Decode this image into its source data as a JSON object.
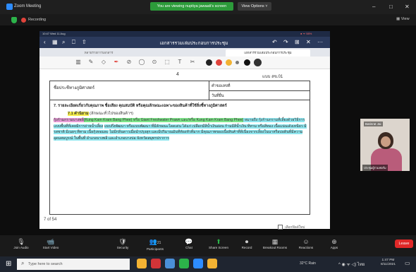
{
  "window": {
    "title": "Zoom Meeting",
    "minimize": "–",
    "maximize": "□",
    "close": "✕"
  },
  "share_banner": "You are viewing nuptiya jawaati's screen",
  "view_options": "View Options ˅",
  "recording": {
    "label": "Recording"
  },
  "view_btn": "▦ View",
  "ipad": {
    "status_time": "10:47 Wed 11 Aug",
    "status_right": "● ᯤ 98%",
    "doc_title": "เอกสารรวมเล่มประกอบการประชุม",
    "tabs": [
      "หลายรายการเอกสาร",
      "เอกสารรวมเล่มประกอบการประชุม"
    ],
    "nav_icons": [
      "‹",
      "▦",
      "⌕",
      "⎕",
      "⇧"
    ],
    "nav_right": [
      "↶",
      "↷",
      "⊞",
      "✕",
      "···"
    ],
    "tools": [
      "▥",
      "✎",
      "◇",
      "✒",
      "⊘",
      "◯",
      "⊙",
      "⬚",
      "T",
      "✂"
    ],
    "colors": [
      "#222222",
      "#e0433b",
      "#f2b233",
      "#777777",
      "#111111",
      "#333333"
    ]
  },
  "doc": {
    "page_number": "4",
    "form": "แบบ สข.01",
    "name_label": "ชื่อประชีทางภูมิศาสตร์",
    "reg_label": "คำขอเลขที่",
    "date_label": "วันที่ยื่น",
    "section7": "7. รายละเอียดเกี่ยวกับคุณภาพ ชื่อเสียง คุณสมบัติ หรือคุณลักษณะเฉพาะของสินค้าที่ใช้สิ่งชี้ทางภูมิศาสตร์",
    "sub71_label": "7.1 คำนิยาม",
    "sub71_rest": " (ลักษณะทั่วไปของสินค้าฯ)",
    "para_pink": "กุ้งก้ามกรามบางพลี",
    "para_en": "(Kung Kam Kram Bang Phee) หรือ Giant Freshwater Prawn และ/หรือ Kung Kam Kram Bang Phee)",
    "para_rest1": " หมายถึง กุ้งก้ามกรามที่เลี้ยงด้วยวิธีการแบบพื้นที่ที่เคยมีการถ่ายน้ำเลี้ยง",
    "para_rest2": "แบบกึ่งพัฒนา หรือแบบพัฒนา ที่มีลักษณะโดดเด่น ได้แก่ เปลือกมีสีน้ำเงินอ่อน ก้ามมีสีน้ำเงิน ทีทาม หรือสีทอง เนื้อแน่นเด้งเหนียว มีรสชาติ มีเนยๆ ทีทาม เนื้อกุ้งหอมละ",
    "para_rest3": "ไม่มีกลิ่นดาวเมื่อนำปรุงสุก และมีปริมาณมันทีท้องหัวที่มาก มีคุณภาพของเนื้อสินค้าที่ดีเนื่องจากเลี้ยงในนาหรือบ่อดินที่มีความอุดมสมบูรณ์ ในพื้นที่ อำเภอบางพลี และอำเภอบางบ่อ จังหวัดสมุทรปราการ",
    "page_count": "7 of 54",
    "checkbox_label": "เลือกฟิลด์ใหม่"
  },
  "video": {
    "name": "Batinrat Jai",
    "label": "ประชุมผู้ร่วมฟอรั่ม"
  },
  "zoom_bar": [
    {
      "icon": "🎙",
      "label": "Join Audio"
    },
    {
      "icon": "📹",
      "label": "Start Video"
    },
    {
      "icon": "🛡",
      "label": "Security"
    },
    {
      "icon": "👥",
      "label": "Participants"
    },
    {
      "icon": "💬",
      "label": "Chat"
    },
    {
      "icon": "⬆",
      "label": "Share Screen"
    },
    {
      "icon": "⏺",
      "label": "Record"
    },
    {
      "icon": "▦",
      "label": "Breakout Rooms"
    },
    {
      "icon": "☺",
      "label": "Reactions"
    },
    {
      "icon": "⊕",
      "label": "Apps"
    }
  ],
  "participants_count": "21",
  "leave": "Leave",
  "taskbar": {
    "search_placeholder": "Type here to search",
    "weather": "32°C Rain",
    "sys": "^ ◉ ᯤ ◁) ไทย",
    "time": "1:47 PM",
    "date": "8/11/2021",
    "icon_colors": [
      "#f2b233",
      "#d13438",
      "#4a90d9",
      "#2cb34a",
      "#2d8cff"
    ]
  }
}
